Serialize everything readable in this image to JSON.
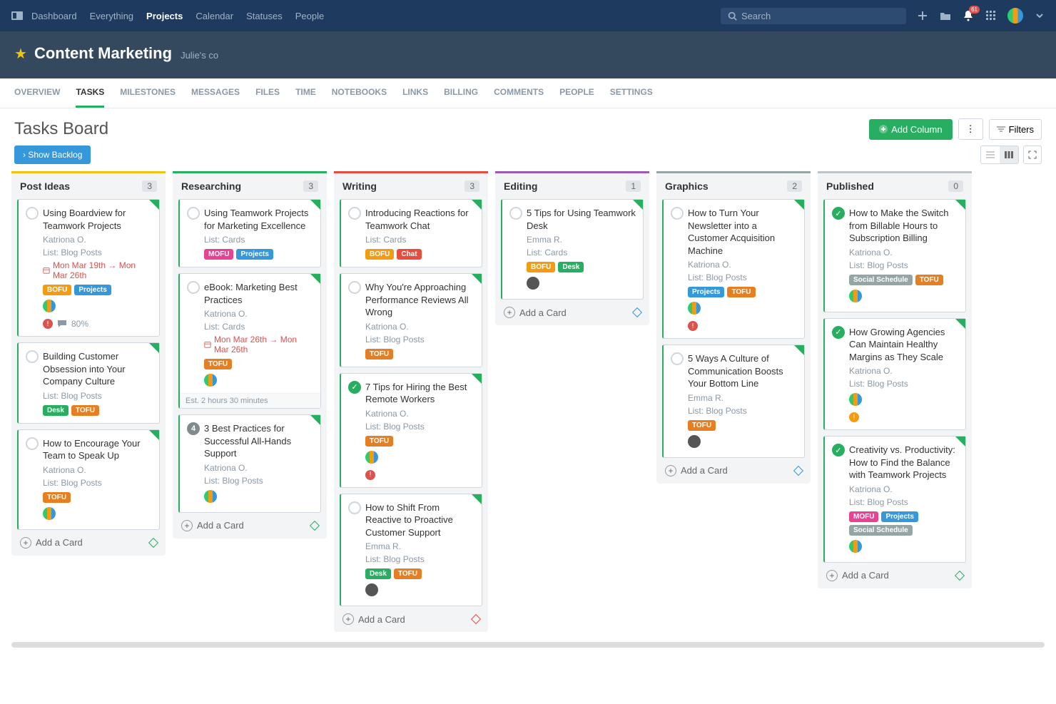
{
  "nav": {
    "items": [
      "Dashboard",
      "Everything",
      "Projects",
      "Calendar",
      "Statuses",
      "People"
    ],
    "active": "Projects",
    "search_placeholder": "Search",
    "notif_count": "61"
  },
  "project": {
    "title": "Content Marketing",
    "owner": "Julie's co"
  },
  "tabs": {
    "items": [
      "OVERVIEW",
      "TASKS",
      "MILESTONES",
      "MESSAGES",
      "FILES",
      "TIME",
      "NOTEBOOKS",
      "LINKS",
      "BILLING",
      "COMMENTS",
      "PEOPLE",
      "SETTINGS"
    ],
    "active": "TASKS"
  },
  "page": {
    "title": "Tasks Board",
    "add_column": "Add Column",
    "filters": "Filters",
    "show_backlog": "› Show Backlog",
    "add_card": "Add a Card"
  },
  "columns": [
    {
      "title": "Post Ideas",
      "count": "3",
      "color": "#f1c40f",
      "diamond": "#27ae60",
      "cards": [
        {
          "title": "Using Boardview for Teamwork Projects",
          "assignee": "Katriona O.",
          "list": "List: Blog Posts",
          "date": "Mon Mar 19th → Mon Mar 26th",
          "tags": [
            "BOFU",
            "Projects"
          ],
          "avatars": true,
          "progress": "80%",
          "warn": true,
          "completed": false
        },
        {
          "title": "Building Customer Obsession into Your Company Culture",
          "list": "List: Blog Posts",
          "tags": [
            "Desk",
            "TOFU"
          ],
          "completed": false
        },
        {
          "title": "How to Encourage Your Team to Speak Up",
          "assignee": "Katriona O.",
          "list": "List: Blog Posts",
          "tags": [
            "TOFU"
          ],
          "avatars": true,
          "completed": false
        }
      ]
    },
    {
      "title": "Researching",
      "count": "3",
      "color": "#27ae60",
      "diamond": "#27ae60",
      "cards": [
        {
          "title": "Using Teamwork Projects for Marketing Excellence",
          "list": "List: Cards",
          "tags": [
            "MOFU",
            "Projects"
          ],
          "completed": false
        },
        {
          "title": "eBook: Marketing Best Practices",
          "assignee": "Katriona O.",
          "list": "List: Cards",
          "date": "Mon Mar 26th → Mon Mar 26th",
          "tags": [
            "TOFU"
          ],
          "avatars": true,
          "est": "Est. 2 hours 30 minutes",
          "completed": false
        },
        {
          "title": "3 Best Practices for Successful All-Hands Support",
          "assignee": "Katriona O.",
          "list": "List: Blog Posts",
          "avatars": true,
          "numbered": "4",
          "completed": false
        }
      ]
    },
    {
      "title": "Writing",
      "count": "3",
      "color": "#e74c3c",
      "diamond": "#e74c3c",
      "cards": [
        {
          "title": "Introducing Reactions for Teamwork Chat",
          "list": "List: Cards",
          "tags": [
            "BOFU",
            "Chat"
          ],
          "completed": false
        },
        {
          "title": "Why You're Approaching Performance Reviews All Wrong",
          "assignee": "Katriona O.",
          "list": "List: Blog Posts",
          "tags": [
            "TOFU"
          ],
          "completed": false
        },
        {
          "title": "7 Tips for Hiring the Best Remote Workers",
          "assignee": "Katriona O.",
          "list": "List: Blog Posts",
          "tags": [
            "TOFU"
          ],
          "avatars": true,
          "warn": true,
          "completed": true
        },
        {
          "title": "How to Shift From Reactive to Proactive Customer Support",
          "assignee": "Emma R.",
          "list": "List: Blog Posts",
          "tags": [
            "Desk",
            "TOFU"
          ],
          "av_sm": true,
          "completed": false
        }
      ]
    },
    {
      "title": "Editing",
      "count": "1",
      "color": "#9b59b6",
      "diamond": "#3498db",
      "cards": [
        {
          "title": "5 Tips for Using Teamwork Desk",
          "assignee": "Emma R.",
          "list": "List: Cards",
          "tags": [
            "BOFU",
            "Desk"
          ],
          "av_sm": true,
          "completed": false
        }
      ]
    },
    {
      "title": "Graphics",
      "count": "2",
      "color": "#95a5a6",
      "diamond": "#3498db",
      "cards": [
        {
          "title": "How to Turn Your Newsletter into a Customer Acquisition Machine",
          "assignee": "Katriona O.",
          "list": "List: Blog Posts",
          "tags": [
            "Projects",
            "TOFU"
          ],
          "avatars": true,
          "warn": true,
          "completed": false
        },
        {
          "title": "5 Ways A Culture of Communication Boosts Your Bottom Line",
          "assignee": "Emma R.",
          "list": "List: Blog Posts",
          "tags": [
            "TOFU"
          ],
          "av_sm": true,
          "completed": false
        }
      ]
    },
    {
      "title": "Published",
      "count": "0",
      "color": "#bdc3c7",
      "diamond": "#27ae60",
      "cards": [
        {
          "title": "How to Make the Switch from Billable Hours to Subscription Billing",
          "assignee": "Katriona O.",
          "list": "List: Blog Posts",
          "tags": [
            "SocialSchedule",
            "TOFU"
          ],
          "avatars": true,
          "completed": true
        },
        {
          "title": "How Growing Agencies Can Maintain Healthy Margins as They Scale",
          "assignee": "Katriona O.",
          "list": "List: Blog Posts",
          "avatars": true,
          "info": true,
          "completed": true
        },
        {
          "title": "Creativity vs. Productivity: How to Find the Balance with Teamwork Projects",
          "assignee": "Katriona O.",
          "list": "List: Blog Posts",
          "tags": [
            "MOFU",
            "Projects",
            "SocialSchedule"
          ],
          "avatars": true,
          "completed": true
        }
      ]
    }
  ]
}
